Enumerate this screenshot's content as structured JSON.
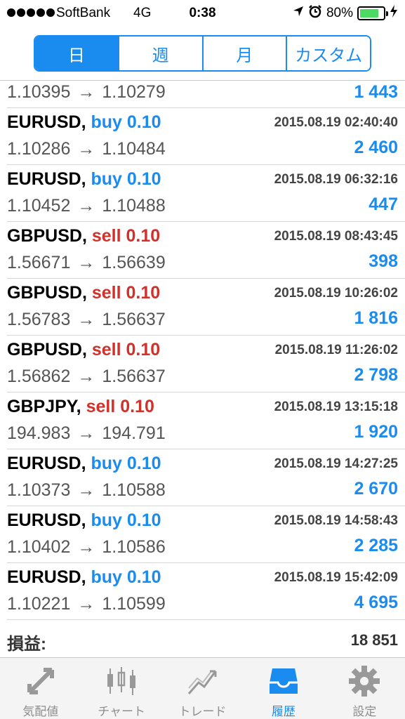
{
  "status_bar": {
    "carrier": "SoftBank",
    "network": "4G",
    "time": "0:38",
    "battery": "80%",
    "battery_level": 0.8
  },
  "periods": [
    {
      "label": "日",
      "active": true
    },
    {
      "label": "週",
      "active": false
    },
    {
      "label": "月",
      "active": false
    },
    {
      "label": "カスタム",
      "active": false
    }
  ],
  "trades": [
    {
      "symbol": "",
      "side": "",
      "side_type": "",
      "time": "",
      "open": "1.10395",
      "close": "1.10279",
      "profit": "1 443",
      "partial": true
    },
    {
      "symbol": "EURUSD,",
      "side": "buy 0.10",
      "side_type": "buy",
      "time": "2015.08.19 02:40:40",
      "open": "1.10286",
      "close": "1.10484",
      "profit": "2 460"
    },
    {
      "symbol": "EURUSD,",
      "side": "buy 0.10",
      "side_type": "buy",
      "time": "2015.08.19 06:32:16",
      "open": "1.10452",
      "close": "1.10488",
      "profit": "447"
    },
    {
      "symbol": "GBPUSD,",
      "side": "sell 0.10",
      "side_type": "sell",
      "time": "2015.08.19 08:43:45",
      "open": "1.56671",
      "close": "1.56639",
      "profit": "398"
    },
    {
      "symbol": "GBPUSD,",
      "side": "sell 0.10",
      "side_type": "sell",
      "time": "2015.08.19 10:26:02",
      "open": "1.56783",
      "close": "1.56637",
      "profit": "1 816"
    },
    {
      "symbol": "GBPUSD,",
      "side": "sell 0.10",
      "side_type": "sell",
      "time": "2015.08.19 11:26:02",
      "open": "1.56862",
      "close": "1.56637",
      "profit": "2 798"
    },
    {
      "symbol": "GBPJPY,",
      "side": "sell 0.10",
      "side_type": "sell",
      "time": "2015.08.19 13:15:18",
      "open": "194.983",
      "close": "194.791",
      "profit": "1 920"
    },
    {
      "symbol": "EURUSD,",
      "side": "buy 0.10",
      "side_type": "buy",
      "time": "2015.08.19 14:27:25",
      "open": "1.10373",
      "close": "1.10588",
      "profit": "2 670"
    },
    {
      "symbol": "EURUSD,",
      "side": "buy 0.10",
      "side_type": "buy",
      "time": "2015.08.19 14:58:43",
      "open": "1.10402",
      "close": "1.10586",
      "profit": "2 285"
    },
    {
      "symbol": "EURUSD,",
      "side": "buy 0.10",
      "side_type": "buy",
      "time": "2015.08.19 15:42:09",
      "open": "1.10221",
      "close": "1.10599",
      "profit": "4 695"
    }
  ],
  "arrow": "→",
  "summary": {
    "label": "損益:",
    "value": "18 851"
  },
  "tabs": [
    {
      "label": "気配値",
      "icon": "quotes-icon",
      "active": false
    },
    {
      "label": "チャート",
      "icon": "chart-icon",
      "active": false
    },
    {
      "label": "トレード",
      "icon": "trade-icon",
      "active": false
    },
    {
      "label": "履歴",
      "icon": "history-icon",
      "active": true
    },
    {
      "label": "設定",
      "icon": "gear-icon",
      "active": false
    }
  ],
  "colors": {
    "accent": "#1a8cf0",
    "sell": "#d0312a",
    "inactive": "#8e8e8e"
  }
}
